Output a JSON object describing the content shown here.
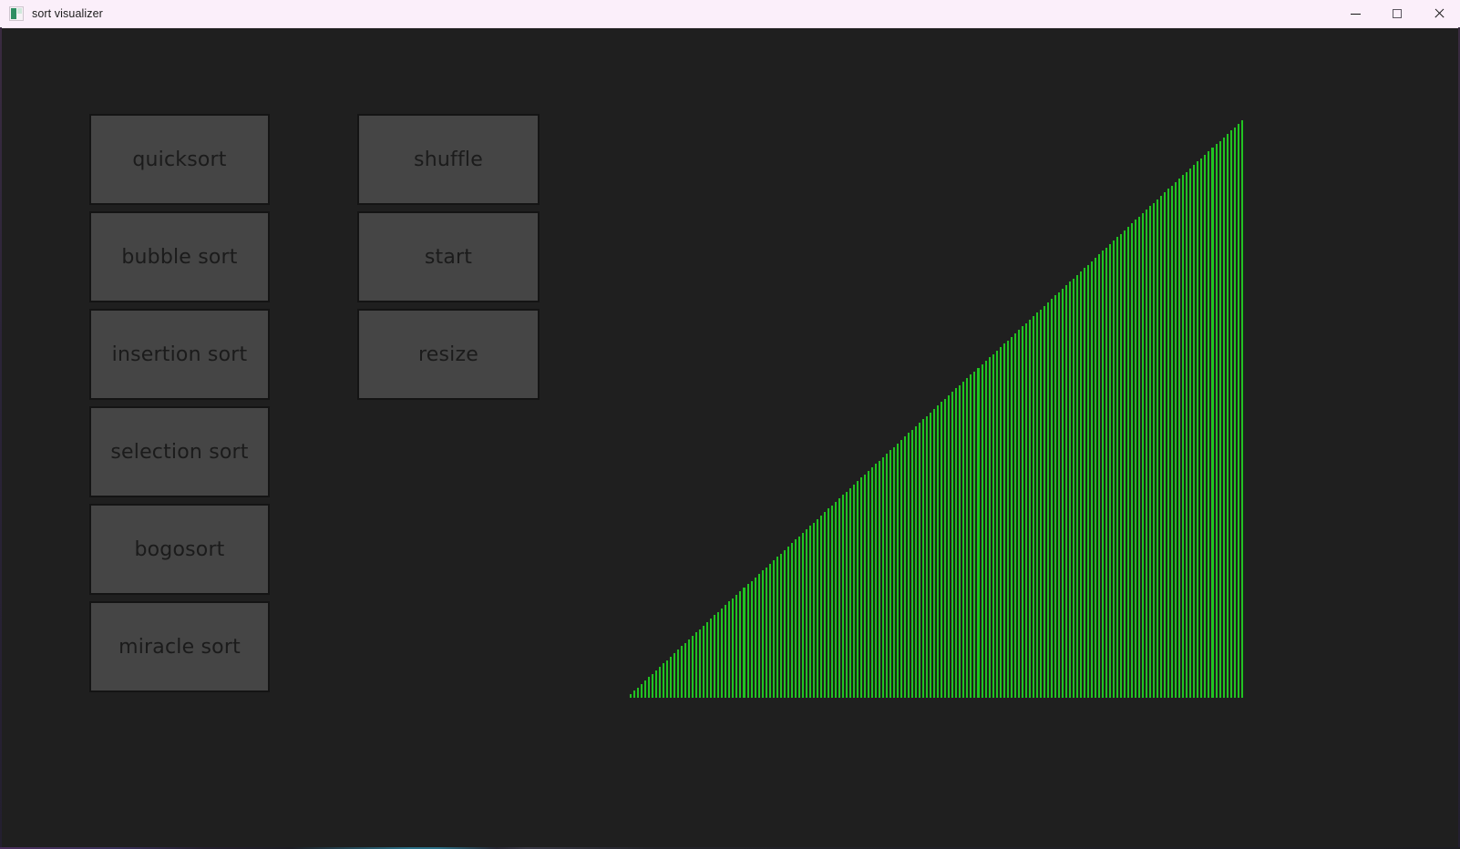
{
  "window": {
    "title": "sort visualizer",
    "icon": "app-icon",
    "background_color": "#1f1f1f",
    "titlebar_color": "#fbeffa"
  },
  "window_controls": [
    {
      "name": "minimize",
      "glyph": "minimize-icon",
      "label": "Minimize"
    },
    {
      "name": "maximize",
      "glyph": "maximize-icon",
      "label": "Maximize"
    },
    {
      "name": "close",
      "glyph": "close-icon",
      "label": "Close"
    }
  ],
  "algorithm_buttons": [
    {
      "label": "quicksort"
    },
    {
      "label": "bubble sort"
    },
    {
      "label": "insertion sort"
    },
    {
      "label": "selection sort"
    },
    {
      "label": "bogosort"
    },
    {
      "label": "miracle sort"
    }
  ],
  "control_buttons": [
    {
      "label": "shuffle"
    },
    {
      "label": "start"
    },
    {
      "label": "resize"
    }
  ],
  "visualizer": {
    "bar_color": "#22c322",
    "background_color": "#1f1f1f",
    "state": "sorted ascending",
    "bar_count": 168
  },
  "chart_data": {
    "type": "bar",
    "title": "",
    "xlabel": "",
    "ylabel": "",
    "grid": false,
    "legend": null,
    "categories": [],
    "values": [],
    "ylim": [
      0,
      168
    ],
    "description": "168 vertical green bars sorted in ascending order forming a right triangle ramp from lower-left to upper-right"
  }
}
